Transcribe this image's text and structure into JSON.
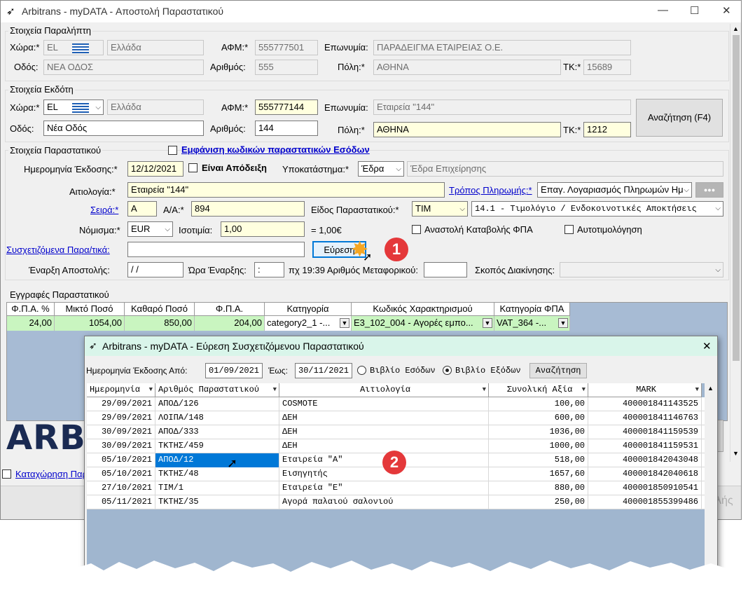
{
  "window": {
    "title": "Arbitrans - myDATA - Αποστολή Παραστατικού",
    "btn_min": "—",
    "btn_max": "☐",
    "btn_close": "✕"
  },
  "receiver": {
    "legend": "Στοιχεία Παραλήπτη",
    "country_label": "Χώρα:*",
    "country_code": "EL",
    "country_name": "Ελλάδα",
    "afm_label": "ΑΦΜ:*",
    "afm": "555777501",
    "name_label": "Επωνυμία:",
    "name": "ΠΑΡΑΔΕΙΓΜΑ ΕΤΑΙΡΕΙΑΣ Ο.Ε.",
    "street_label": "Οδός:",
    "street": "ΝΕΑ ΟΔΟΣ",
    "number_label": "Αριθμός:",
    "number": "555",
    "city_label": "Πόλη:*",
    "city": "ΑΘΗΝΑ",
    "zip_label": "ΤΚ:*",
    "zip": "15689"
  },
  "issuer": {
    "legend": "Στοιχεία Εκδότη",
    "country_label": "Χώρα:*",
    "country_code": "EL",
    "country_name": "Ελλάδα",
    "afm_label": "ΑΦΜ:*",
    "afm": "555777144",
    "name_label": "Επωνυμία:",
    "name": "Εταιρεία \"144\"",
    "street_label": "Οδός:",
    "street": "Νέα Οδός",
    "number_label": "Αριθμός:",
    "number": "144",
    "city_label": "Πόλη:*",
    "city": "ΑΘΗΝΑ",
    "zip_label": "ΤΚ:*",
    "zip": "1212",
    "search_button": "Αναζήτηση (F4)"
  },
  "document": {
    "legend": "Στοιχεία Παραστατικού",
    "show_income_codes": "Εμφάνιση κωδικών παραστατικών Εσόδων",
    "issue_date_label": "Ημερομηνία Έκδοσης:*",
    "issue_date": "12/12/2021",
    "is_receipt_label": "Είναι Απόδειξη",
    "branch_label": "Υποκατάστημα:*",
    "branch": "Έδρα",
    "branch_desc": "Έδρα Επιχείρησης",
    "reason_label": "Αιτιολογία:*",
    "reason": "Εταιρεία \"144\"",
    "payment_label": "Τρόπος Πληρωμής:*",
    "payment": "Επαγ. Λογαριασμός Πληρωμών Ημ",
    "payment_more": "●●●",
    "series_label": "Σειρά:*",
    "series": "A",
    "aa_label": "Α/Α:*",
    "aa": "894",
    "type_label": "Είδος Παραστατικού:*",
    "type": "ΤΙΜ",
    "type_desc": "14.1  - Τιμολόγιο / Ενδοκοινοτικές Αποκτήσεις",
    "currency_label": "Νόμισμα:*",
    "currency": "EUR",
    "parity_label": "Ισοτιμία:",
    "parity": "1,00",
    "parity_result": "= 1,00€",
    "vat_suspension_label": "Αναστολή Καταβολής ΦΠΑ",
    "self_billing_label": "Αυτοτιμολόγηση",
    "related_label": "Συσχετιζόμενα Παρα/τικά:",
    "related": "",
    "find_button": "Εύρεση",
    "dispatch_start_label": "Έναρξη Αποστολής:",
    "dispatch_date": " / /",
    "start_time_label": "Ώρα Έναρξης:",
    "start_time": " :",
    "vehicle_label": "πχ 19:39 Αριθμός Μεταφορικού:",
    "vehicle": "",
    "purpose_label": "Σκοπός Διακίνησης:",
    "purpose": ""
  },
  "entries": {
    "legend": "Εγγραφές Παραστατικού",
    "columns": [
      "Φ.Π.Α. %",
      "Μικτό Ποσό",
      "Καθαρό Ποσό",
      "Φ.Π.Α.",
      "Κατηγορία",
      "Κωδικός Χαρακτηρισμού",
      "Κατηγορία ΦΠΑ"
    ],
    "rows": [
      {
        "vat_pct": "24,00",
        "gross": "1054,00",
        "net": "850,00",
        "vat": "204,00",
        "category": "category2_1  -...",
        "code": "E3_102_004  -  Αγορές εμπο...",
        "vat_category": "VAT_364  -..."
      }
    ]
  },
  "footer": {
    "logo": "ARB",
    "register_link": "Καταχώρηση Παρ",
    "send_hint": "λής"
  },
  "dialog": {
    "title": "Arbitrans - myDATA - Εύρεση Συσχετιζόμενου Παραστατικού",
    "from_label": "Ημερομηνία Έκδοσης Από:",
    "from": "01/09/2021",
    "to_label": "Έως:",
    "to": "30/11/2021",
    "income_label": "Βιβλίο Εσόδων",
    "expense_label": "Βιβλίο Εξόδων",
    "search_button": "Αναζήτηση",
    "columns": [
      "Ημερομηνία",
      "Αριθμός Παραστατικού",
      "Αιτιολογία",
      "Συνολική Αξία",
      "MARK"
    ],
    "rows": [
      {
        "date": "29/09/2021",
        "number": "ΑΠΟΔ/126",
        "reason": "COSMOTE",
        "total": "100,00",
        "mark": "400001841143525"
      },
      {
        "date": "29/09/2021",
        "number": "ΛΟΙΠΑ/148",
        "reason": "ΔΕΗ",
        "total": "600,00",
        "mark": "400001841146763"
      },
      {
        "date": "30/09/2021",
        "number": "ΑΠΟΔ/333",
        "reason": "ΔΕΗ",
        "total": "1036,00",
        "mark": "400001841159539"
      },
      {
        "date": "30/09/2021",
        "number": "ΤΚΤΗΣ/459",
        "reason": "ΔΕΗ",
        "total": "1000,00",
        "mark": "400001841159531"
      },
      {
        "date": "05/10/2021",
        "number": "ΑΠΟΔ/12",
        "reason": "Εταιρεία \"Α\"",
        "total": "518,00",
        "mark": "400001842043048"
      },
      {
        "date": "05/10/2021",
        "number": "ΤΚΤΗΣ/48",
        "reason": "Εισηγητής",
        "total": "1657,60",
        "mark": "400001842040618"
      },
      {
        "date": "27/10/2021",
        "number": "ΤΙΜ/1",
        "reason": "Εταιρεία \"Ε\"",
        "total": "880,00",
        "mark": "400001850910541"
      },
      {
        "date": "05/11/2021",
        "number": "ΤΚΤΗΣ/35",
        "reason": "Αγορά παλαιού σαλονιού",
        "total": "250,00",
        "mark": "400001855399486"
      }
    ]
  },
  "annotations": {
    "step1": "1",
    "step2": "2"
  },
  "colors": {
    "readonly_bg": "#f0f0f0",
    "required_bg": "#ffffdf",
    "entry_row_bg": "#c9f5c0",
    "grid_bg": "#a7bbd4",
    "dialog_title_bg": "#d9f5ea",
    "selection": "#0078d7",
    "badge": "#e4383a"
  }
}
